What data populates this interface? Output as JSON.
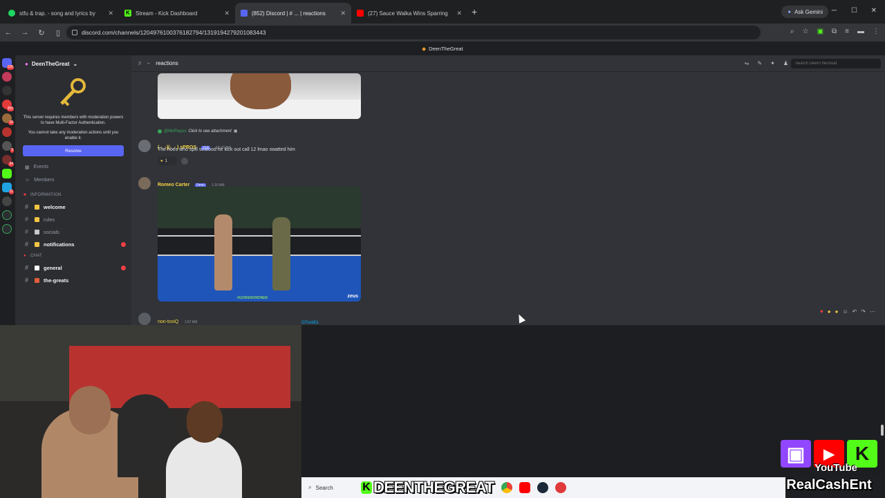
{
  "browser": {
    "tabs": [
      {
        "label": "stfu & trap. - song and lyrics by",
        "favicon_color": "#1ed760",
        "active": false
      },
      {
        "label": "Stream - Kick Dashboard",
        "favicon_color": "#53fc18",
        "active": false
      },
      {
        "label": "(852) Discord | # ... | reactions",
        "favicon_color": "#5865f2",
        "active": true
      },
      {
        "label": "(27) Sauce Walka Wins Sparring",
        "favicon_color": "#ff0000",
        "active": false
      }
    ],
    "gemini_label": "Ask Gemini",
    "url": "discord.com/channels/1204976100376182794/1319194279201083443"
  },
  "discord": {
    "window_title": "DeenTheGreat",
    "server_name": "DeenTheGreat",
    "server_badges": [
      "226",
      "355",
      "16",
      "3",
      "34",
      "11"
    ],
    "mfa_text_1": "This server requires members with moderation powers to have Multi-Factor Authentication.",
    "mfa_text_2": "You cannot take any moderation actions until you enable it.",
    "resolve_label": "Resolve",
    "events_label": "Events",
    "members_label": "Members",
    "category_information": "INFORMATION",
    "category_chat": "CHAT",
    "channels": [
      {
        "name": "welcome",
        "icon_color": "#f5c542",
        "bright": true,
        "unread": false
      },
      {
        "name": "rules",
        "icon_color": "#f5c542",
        "bright": false,
        "unread": false
      },
      {
        "name": "socials",
        "icon_color": "#c8c8c8",
        "bright": false,
        "unread": false
      },
      {
        "name": "notifications",
        "icon_color": "#f5c542",
        "bright": true,
        "unread": true
      },
      {
        "name": "general",
        "icon_color": "#ffffff",
        "bright": true,
        "unread": true
      },
      {
        "name": "the-greats",
        "icon_color": "#e35d3a",
        "bright": true,
        "unread": false
      }
    ],
    "channel_header": "reactions",
    "search_placeholder": "Search DeenTheGreat",
    "messages": {
      "reply_name": "@MoPlayso",
      "reply_attachment": "Click to see attachment",
      "msg1_user": "( -_-)(-_- ) sPROS",
      "msg1_tag": "010",
      "msg1_time": "12:47 AM",
      "msg1_text": "The hoes who spill seafood he kick out call 12 lmao swatted him",
      "msg1_reaction_count": "1",
      "msg2_user": "Romeo Carter",
      "msg2_tag": "Omni",
      "msg2_time": "1:10 AM",
      "video_caption": "#GORIENORDNER",
      "video_logo": "zeus",
      "msg3_user": "non-toxiQ",
      "msg3_time": "1:57 AM",
      "msg3_link": "OTimbEk"
    }
  },
  "stream_overlay": {
    "taskbar_search": "Search",
    "streamer_name": "DEENTHEGREAT",
    "brand_youtube": "YouTube",
    "brand_name": "RealCashEnt"
  },
  "colors": {
    "discord_bg": "#313338",
    "sidebar_bg": "#2b2d31",
    "accent": "#5865f2",
    "twitch": "#9146ff",
    "kick": "#53fc18",
    "youtube": "#ff0000"
  }
}
